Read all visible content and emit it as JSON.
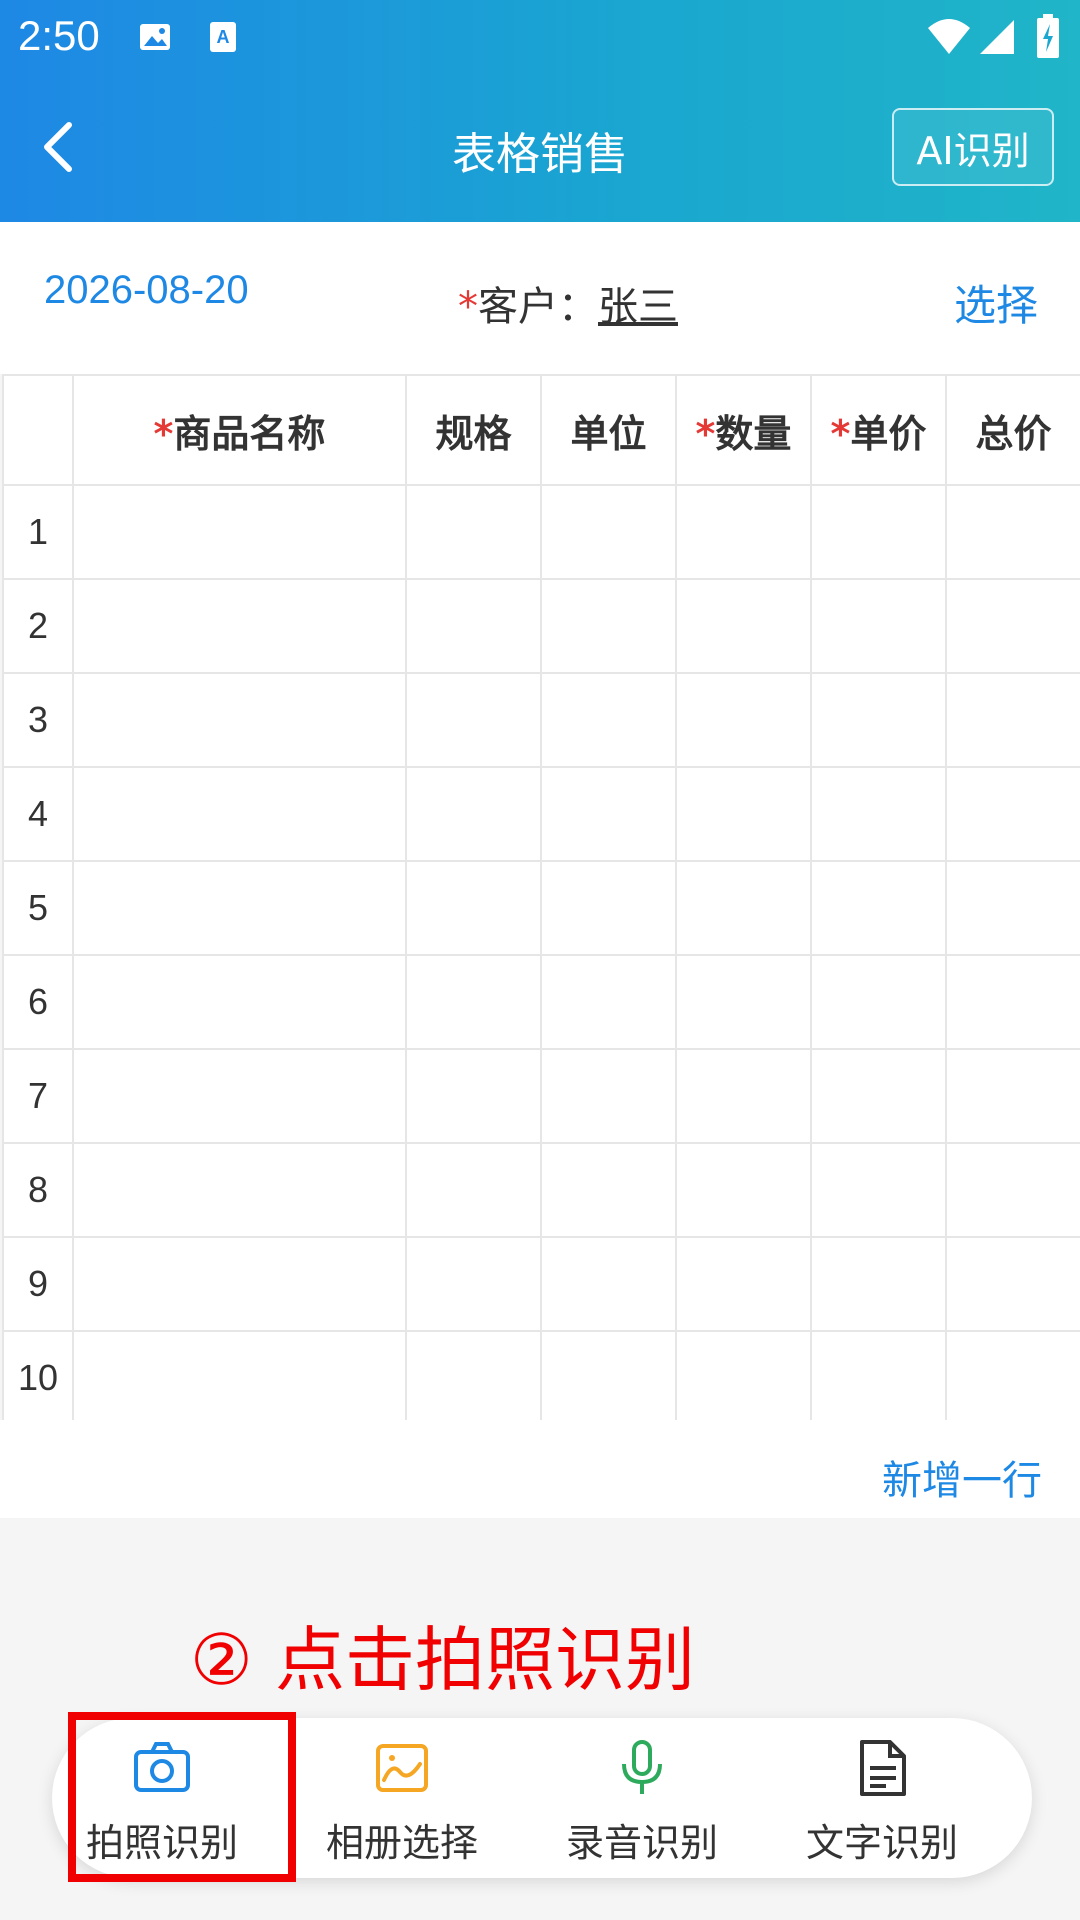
{
  "status_bar": {
    "time": "2:50"
  },
  "nav": {
    "title": "表格销售",
    "ai_button": "AI识别"
  },
  "header": {
    "date": "2026-08-20",
    "required_mark": "*",
    "customer_label": "客户：",
    "customer_name": "张三",
    "select_link": "选择"
  },
  "table": {
    "columns": [
      {
        "label": "",
        "required": false
      },
      {
        "label": "商品名称",
        "required": true
      },
      {
        "label": "规格",
        "required": false
      },
      {
        "label": "单位",
        "required": false
      },
      {
        "label": "数量",
        "required": true
      },
      {
        "label": "单价",
        "required": true
      },
      {
        "label": "总价",
        "required": false
      }
    ],
    "rows": [
      "1",
      "2",
      "3",
      "4",
      "5",
      "6",
      "7",
      "8",
      "9",
      "10"
    ]
  },
  "add_row": "新增一行",
  "annotation": "② 点击拍照识别",
  "toolbar": {
    "items": [
      {
        "label": "拍照识别",
        "icon": "camera-icon",
        "color": "#1e88e5"
      },
      {
        "label": "相册选择",
        "icon": "image-icon",
        "color": "#f5a623"
      },
      {
        "label": "录音识别",
        "icon": "microphone-icon",
        "color": "#2eaa5c"
      },
      {
        "label": "文字识别",
        "icon": "document-icon",
        "color": "#333333"
      }
    ]
  },
  "colors": {
    "accent": "#1e88e5",
    "required": "#e53935",
    "annotation": "#f00000"
  }
}
